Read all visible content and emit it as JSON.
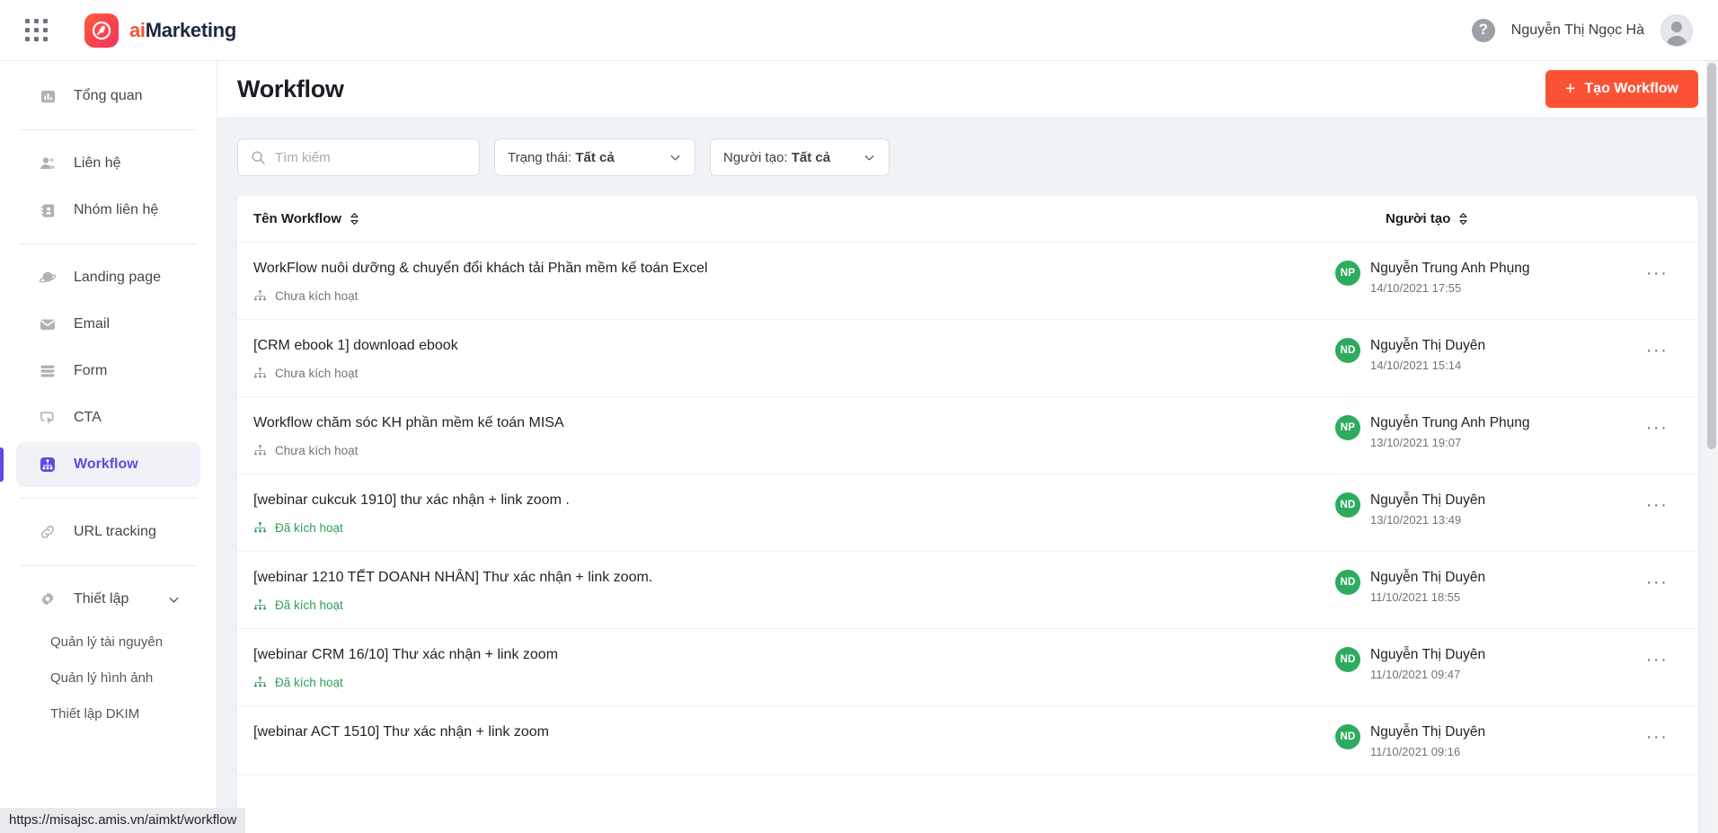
{
  "topbar": {
    "apps_icon": "grid-apps-icon",
    "brand_ai": "ai",
    "brand_marketing": "Marketing",
    "help_label": "?",
    "user_name": "Nguyễn Thị Ngọc Hà"
  },
  "sidebar": {
    "items": [
      {
        "label": "Tổng quan",
        "icon": "chart-bar-icon",
        "active": false
      },
      {
        "label": "Liên hệ",
        "icon": "people-icon",
        "active": false
      },
      {
        "label": "Nhóm liên hệ",
        "icon": "contact-book-icon",
        "active": false
      },
      {
        "label": "Landing page",
        "icon": "planet-icon",
        "active": false
      },
      {
        "label": "Email",
        "icon": "envelope-icon",
        "active": false
      },
      {
        "label": "Form",
        "icon": "form-lines-icon",
        "active": false
      },
      {
        "label": "CTA",
        "icon": "cta-cursor-icon",
        "active": false
      },
      {
        "label": "Workflow",
        "icon": "workflow-tree-icon",
        "active": true
      },
      {
        "label": "URL tracking",
        "icon": "link-icon",
        "active": false
      },
      {
        "label": "Thiết lập",
        "icon": "gear-icon",
        "active": false
      }
    ],
    "sub_items": [
      {
        "label": "Quản lý tài nguyên"
      },
      {
        "label": "Quản lý hình ảnh"
      },
      {
        "label": "Thiết lập DKIM"
      }
    ]
  },
  "page": {
    "title": "Workflow",
    "create_button": "Tạo Workflow",
    "create_button_plus": "+"
  },
  "filters": {
    "search_placeholder": "Tìm kiếm",
    "search_value": "",
    "status_label": "Trạng thái:",
    "status_value": "Tất cả",
    "creator_label": "Người tạo:",
    "creator_value": "Tất cả"
  },
  "table": {
    "col_name": "Tên Workflow",
    "col_creator": "Người tạo",
    "rows": [
      {
        "name": "WorkFlow nuôi dưỡng & chuyển đổi khách tải Phần mềm kế toán Excel",
        "status": "Chưa kích hoạt",
        "status_active": false,
        "creator": "Nguyễn Trung Anh Phụng",
        "initials": "NP",
        "date": "14/10/2021 17:55"
      },
      {
        "name": "[CRM ebook 1] download ebook",
        "status": "Chưa kích hoạt",
        "status_active": false,
        "creator": "Nguyễn Thị Duyên",
        "initials": "ND",
        "date": "14/10/2021 15:14"
      },
      {
        "name": "Workflow chăm sóc KH phần mềm kế toán MISA",
        "status": "Chưa kích hoạt",
        "status_active": false,
        "creator": "Nguyễn Trung Anh Phụng",
        "initials": "NP",
        "date": "13/10/2021 19:07"
      },
      {
        "name": "[webinar cukcuk 1910] thư xác nhận + link zoom .",
        "status": "Đã kích hoạt",
        "status_active": true,
        "creator": "Nguyễn Thị Duyên",
        "initials": "ND",
        "date": "13/10/2021 13:49"
      },
      {
        "name": "[webinar 1210 TẾT DOANH NHÂN] Thư xác nhận + link zoom.",
        "status": "Đã kích hoạt",
        "status_active": true,
        "creator": "Nguyễn Thị Duyên",
        "initials": "ND",
        "date": "11/10/2021 18:55"
      },
      {
        "name": "[webinar CRM 16/10] Thư xác nhận + link zoom",
        "status": "Đã kích hoạt",
        "status_active": true,
        "creator": "Nguyễn Thị Duyên",
        "initials": "ND",
        "date": "11/10/2021 09:47"
      },
      {
        "name": "[webinar ACT 1510] Thư xác nhận + link zoom",
        "status": "",
        "status_active": true,
        "creator": "Nguyễn Thị Duyên",
        "initials": "ND",
        "date": "11/10/2021 09:16"
      }
    ],
    "row_menu": "···"
  },
  "statusbar": {
    "url": "https://misajsc.amis.vn/aimkt/workflow"
  },
  "colors": {
    "accent_orange": "#fb5235",
    "accent_purple": "#5b4be0",
    "status_green": "#2e9e5b",
    "avatar_green": "#2eab5e"
  }
}
